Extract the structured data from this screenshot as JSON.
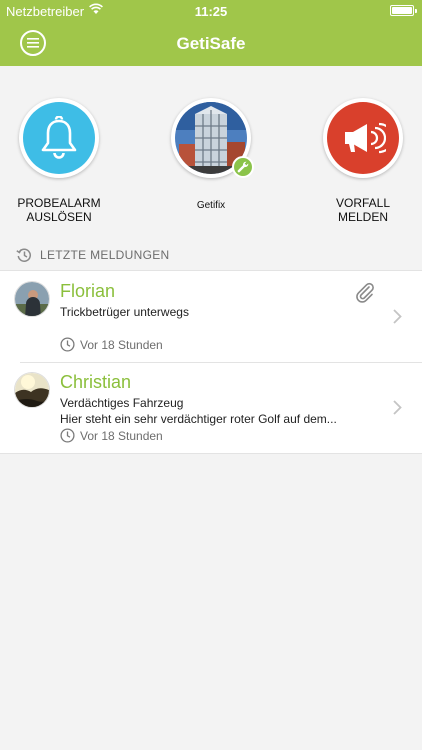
{
  "status_bar": {
    "carrier": "Netzbetreiber",
    "time": "11:25"
  },
  "nav": {
    "title": "GetiSafe",
    "menu_icon": "menu-icon"
  },
  "actions": {
    "test_alarm": {
      "label_line1": "PROBEALARM",
      "label_line2": "AUSLÖSEN",
      "icon": "bell-icon",
      "color": "#3ebde6"
    },
    "location": {
      "label": "Getifix",
      "icon": "wrench-icon",
      "badge_color": "#8bc34a"
    },
    "report": {
      "label_line1": "VORFALL",
      "label_line2": "MELDEN",
      "icon": "megaphone-icon",
      "color": "#d9402c"
    }
  },
  "recent": {
    "header": "LETZTE MELDUNGEN",
    "items": [
      {
        "name": "Florian",
        "subject": "Trickbetrüger unterwegs",
        "preview": "",
        "time": "Vor 18 Stunden",
        "has_attachment": true
      },
      {
        "name": "Christian",
        "subject": "Verdächtiges Fahrzeug",
        "preview": "Hier steht ein sehr verdächtiger roter Golf auf dem...",
        "time": "Vor 18 Stunden",
        "has_attachment": false
      }
    ]
  },
  "colors": {
    "brand": "#a0c64a",
    "name_green": "#8bbf3c"
  }
}
